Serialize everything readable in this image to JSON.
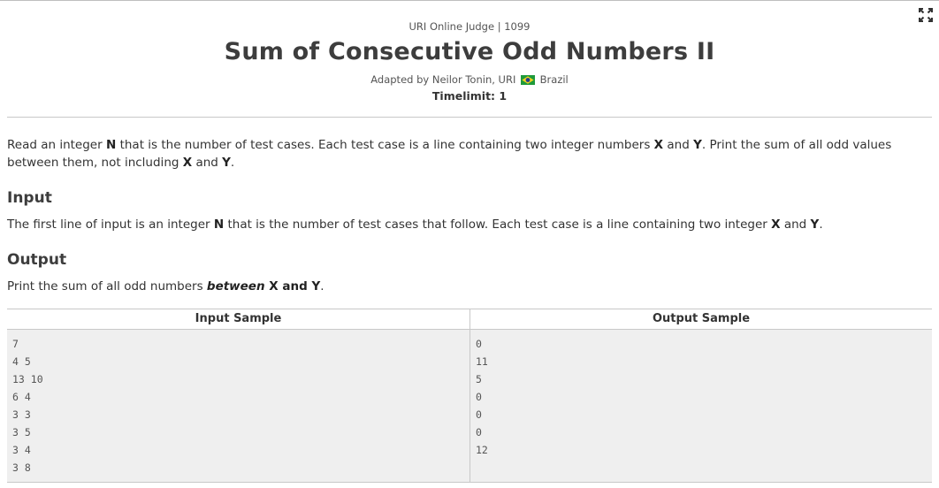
{
  "header": {
    "crumb": "URI Online Judge | 1099",
    "title": "Sum of Consecutive Odd Numbers II",
    "adapted_prefix": "Adapted by Neilor Tonin, URI",
    "country": "Brazil",
    "timelimit": "Timelimit: 1"
  },
  "description": {
    "part1": "Read an integer ",
    "n": "N",
    "part2": " that is the number of test cases. Each test case is a line containing two integer numbers ",
    "x": "X",
    "and1": " and ",
    "y": "Y",
    "part3": ". Print the sum of all odd values between them, not including ",
    "x2": "X",
    "and2": " and ",
    "y2": "Y",
    "end": "."
  },
  "input": {
    "heading": "Input",
    "part1": "The first line of input is an integer ",
    "n": "N",
    "part2": " that is the number of test cases that follow. Each test case is a line containing two integer ",
    "x": "X",
    "and": " and ",
    "y": "Y",
    "end": "."
  },
  "output": {
    "heading": "Output",
    "part1": "Print the sum of all odd numbers ",
    "between": "between",
    "x_and_y": " X and Y",
    "end": "."
  },
  "samples": {
    "input_header": "Input Sample",
    "output_header": "Output Sample",
    "input_lines": [
      "7",
      "4 5",
      "13 10",
      "6 4",
      "3 3",
      "3 5",
      "3 4",
      "3 8"
    ],
    "output_lines": [
      "0",
      "11",
      "5",
      "0",
      "0",
      "0",
      "12"
    ]
  },
  "icons": {
    "fullscreen": "expand-icon",
    "flag": "brazil-flag-icon"
  }
}
